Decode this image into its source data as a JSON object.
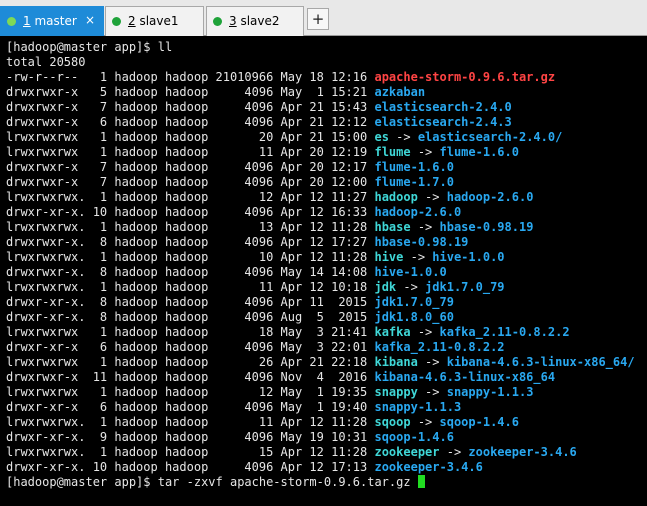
{
  "tabs": [
    {
      "num": "1",
      "name": " master",
      "active": true
    },
    {
      "num": "2",
      "name": " slave1",
      "active": false
    },
    {
      "num": "3",
      "name": " slave2",
      "active": false
    }
  ],
  "close_glyph": "×",
  "new_tab_glyph": "+",
  "terminal": {
    "prompt1": "[hadoop@master app]$ ll",
    "total": "total 20580",
    "entries": [
      [
        "-rw-r--r--   1 hadoop hadoop 21010966 May 18 12:16 ",
        "apache-storm-0.9.6.tar.gz",
        "",
        ""
      ],
      [
        "drwxrwxr-x   5 hadoop hadoop     4096 May  1 15:21 ",
        "azkaban",
        "",
        ""
      ],
      [
        "drwxrwxr-x   7 hadoop hadoop     4096 Apr 21 15:43 ",
        "elasticsearch-2.4.0",
        "",
        ""
      ],
      [
        "drwxrwxr-x   6 hadoop hadoop     4096 Apr 21 12:12 ",
        "elasticsearch-2.4.3",
        "",
        ""
      ],
      [
        "lrwxrwxrwx   1 hadoop hadoop       20 Apr 21 15:00 ",
        "es",
        " -> ",
        "elasticsearch-2.4.0/"
      ],
      [
        "lrwxrwxrwx   1 hadoop hadoop       11 Apr 20 12:19 ",
        "flume",
        " -> ",
        "flume-1.6.0"
      ],
      [
        "drwxrwxr-x   7 hadoop hadoop     4096 Apr 20 12:17 ",
        "flume-1.6.0",
        "",
        ""
      ],
      [
        "drwxrwxr-x   7 hadoop hadoop     4096 Apr 20 12:00 ",
        "flume-1.7.0",
        "",
        ""
      ],
      [
        "lrwxrwxrwx.  1 hadoop hadoop       12 Apr 12 11:27 ",
        "hadoop",
        " -> ",
        "hadoop-2.6.0"
      ],
      [
        "drwxr-xr-x. 10 hadoop hadoop     4096 Apr 12 16:33 ",
        "hadoop-2.6.0",
        "",
        ""
      ],
      [
        "lrwxrwxrwx.  1 hadoop hadoop       13 Apr 12 11:28 ",
        "hbase",
        " -> ",
        "hbase-0.98.19"
      ],
      [
        "drwxrwxr-x.  8 hadoop hadoop     4096 Apr 12 17:27 ",
        "hbase-0.98.19",
        "",
        ""
      ],
      [
        "lrwxrwxrwx.  1 hadoop hadoop       10 Apr 12 11:28 ",
        "hive",
        " -> ",
        "hive-1.0.0"
      ],
      [
        "drwxrwxr-x.  8 hadoop hadoop     4096 May 14 14:08 ",
        "hive-1.0.0",
        "",
        ""
      ],
      [
        "lrwxrwxrwx.  1 hadoop hadoop       11 Apr 12 10:18 ",
        "jdk",
        " -> ",
        "jdk1.7.0_79"
      ],
      [
        "drwxr-xr-x.  8 hadoop hadoop     4096 Apr 11  2015 ",
        "jdk1.7.0_79",
        "",
        ""
      ],
      [
        "drwxr-xr-x.  8 hadoop hadoop     4096 Aug  5  2015 ",
        "jdk1.8.0_60",
        "",
        ""
      ],
      [
        "lrwxrwxrwx   1 hadoop hadoop       18 May  3 21:41 ",
        "kafka",
        " -> ",
        "kafka_2.11-0.8.2.2"
      ],
      [
        "drwxr-xr-x   6 hadoop hadoop     4096 May  3 22:01 ",
        "kafka_2.11-0.8.2.2",
        "",
        ""
      ],
      [
        "lrwxrwxrwx   1 hadoop hadoop       26 Apr 21 22:18 ",
        "kibana",
        " -> ",
        "kibana-4.6.3-linux-x86_64/"
      ],
      [
        "drwxrwxr-x  11 hadoop hadoop     4096 Nov  4  2016 ",
        "kibana-4.6.3-linux-x86_64",
        "",
        ""
      ],
      [
        "lrwxrwxrwx   1 hadoop hadoop       12 May  1 19:35 ",
        "snappy",
        " -> ",
        "snappy-1.1.3"
      ],
      [
        "drwxr-xr-x   6 hadoop hadoop     4096 May  1 19:40 ",
        "snappy-1.1.3",
        "",
        ""
      ],
      [
        "lrwxrwxrwx.  1 hadoop hadoop       11 Apr 12 11:28 ",
        "sqoop",
        " -> ",
        "sqoop-1.4.6"
      ],
      [
        "drwxr-xr-x.  9 hadoop hadoop     4096 May 19 10:31 ",
        "sqoop-1.4.6",
        "",
        ""
      ],
      [
        "lrwxrwxrwx.  1 hadoop hadoop       15 Apr 12 11:28 ",
        "zookeeper",
        " -> ",
        "zookeeper-3.4.6"
      ],
      [
        "drwxr-xr-x. 10 hadoop hadoop     4096 Apr 12 17:13 ",
        "zookeeper-3.4.6",
        "",
        ""
      ]
    ],
    "prompt2": "[hadoop@master app]$ tar -zxvf apache-storm-0.9.6.tar.gz "
  }
}
